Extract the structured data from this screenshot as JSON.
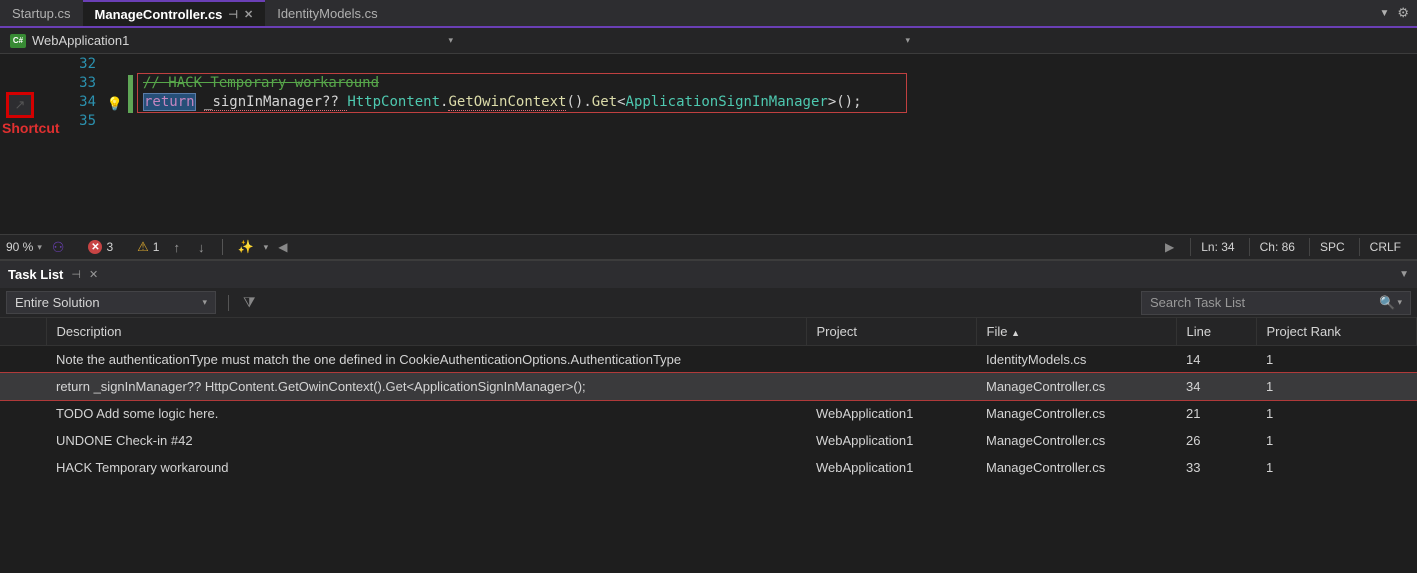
{
  "tabs": {
    "items": [
      {
        "label": "Startup.cs",
        "active": false
      },
      {
        "label": "ManageController.cs",
        "active": true
      },
      {
        "label": "IdentityModels.cs",
        "active": false
      }
    ]
  },
  "nav": {
    "icon_label": "C#",
    "context": "WebApplication1"
  },
  "shortcut_annotation": "Shortcut",
  "code": {
    "lines": [
      "32",
      "33",
      "34",
      "35"
    ],
    "comment": "// HACK Temporary workaround",
    "return_kw": "return",
    "ident1": "_signInManager?? ",
    "type1": "HttpContent",
    "dot": ".",
    "method1": "GetOwinContext",
    "parens1": "().",
    "method2": "Get",
    "generic_open": "<",
    "type2": "ApplicationSignInManager",
    "generic_close": ">",
    "tail": "();"
  },
  "status": {
    "zoom": "90 %",
    "errors": "3",
    "warnings": "1",
    "line_label": "Ln: 34",
    "char_label": "Ch: 86",
    "indent": "SPC",
    "eol": "CRLF"
  },
  "task_panel": {
    "title": "Task List",
    "scope": "Entire Solution",
    "search_placeholder": "Search Task List",
    "columns": {
      "desc": "Description",
      "project": "Project",
      "file": "File",
      "line": "Line",
      "rank": "Project Rank"
    },
    "rows": [
      {
        "desc": "Note the authenticationType must match the one defined in CookieAuthenticationOptions.AuthenticationType",
        "project": "",
        "file": "IdentityModels.cs",
        "line": "14",
        "rank": "1",
        "selected": false
      },
      {
        "desc": "return _signInManager?? HttpContent.GetOwinContext().Get<ApplicationSignInManager>();",
        "project": "",
        "file": "ManageController.cs",
        "line": "34",
        "rank": "1",
        "selected": true
      },
      {
        "desc": "TODO Add some logic here.",
        "project": "WebApplication1",
        "file": "ManageController.cs",
        "line": "21",
        "rank": "1",
        "selected": false
      },
      {
        "desc": "UNDONE Check-in #42",
        "project": "WebApplication1",
        "file": "ManageController.cs",
        "line": "26",
        "rank": "1",
        "selected": false
      },
      {
        "desc": "HACK Temporary workaround",
        "project": "WebApplication1",
        "file": "ManageController.cs",
        "line": "33",
        "rank": "1",
        "selected": false
      }
    ]
  }
}
